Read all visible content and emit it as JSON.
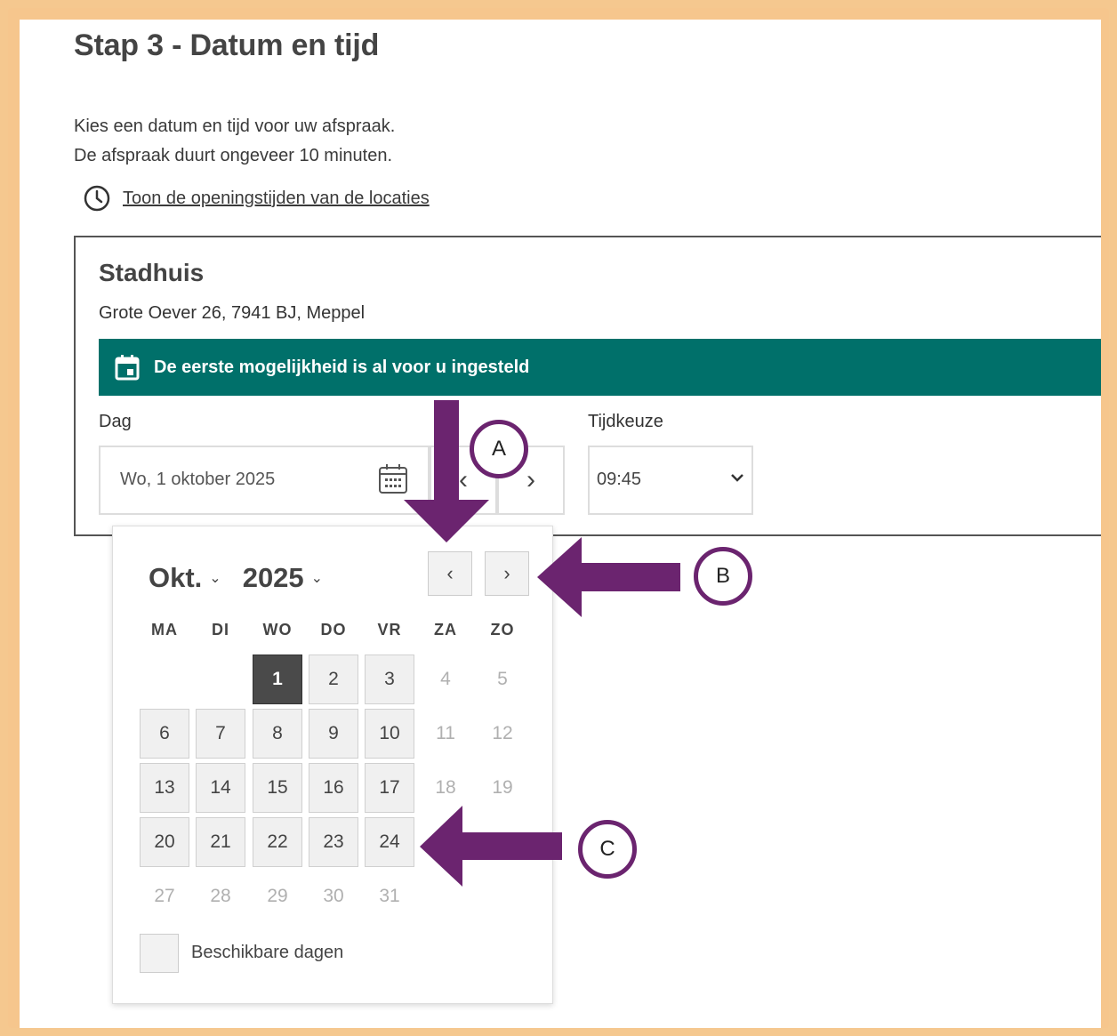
{
  "page": {
    "title": "Stap 3 - Datum en tijd",
    "intro_line1": "Kies een datum en tijd voor uw afspraak.",
    "intro_line2": "De afspraak duurt ongeveer 10 minuten.",
    "hours_link": "Toon de openingstijden van de locaties"
  },
  "location": {
    "name": "Stadhuis",
    "address": "Grote Oever 26, 7941 BJ, Meppel",
    "banner": "De eerste mogelijkheid is al voor u ingesteld",
    "day_label": "Dag",
    "date_value": "Wo, 1 oktober 2025",
    "time_label": "Tijdkeuze",
    "time_value": "09:45",
    "prev_symbol": "‹",
    "next_symbol": "›"
  },
  "calendar": {
    "month": "Okt.",
    "year": "2025",
    "prev_symbol": "‹",
    "next_symbol": "›",
    "weekdays": [
      "MA",
      "DI",
      "WO",
      "DO",
      "VR",
      "ZA",
      "ZO"
    ],
    "weeks": [
      [
        {
          "d": "",
          "s": "empty"
        },
        {
          "d": "",
          "s": "empty"
        },
        {
          "d": "1",
          "s": "selected"
        },
        {
          "d": "2",
          "s": "available"
        },
        {
          "d": "3",
          "s": "available"
        },
        {
          "d": "4",
          "s": "disabled"
        },
        {
          "d": "5",
          "s": "disabled"
        }
      ],
      [
        {
          "d": "6",
          "s": "available"
        },
        {
          "d": "7",
          "s": "available"
        },
        {
          "d": "8",
          "s": "available"
        },
        {
          "d": "9",
          "s": "available"
        },
        {
          "d": "10",
          "s": "available"
        },
        {
          "d": "11",
          "s": "disabled"
        },
        {
          "d": "12",
          "s": "disabled"
        }
      ],
      [
        {
          "d": "13",
          "s": "available"
        },
        {
          "d": "14",
          "s": "available"
        },
        {
          "d": "15",
          "s": "available"
        },
        {
          "d": "16",
          "s": "available"
        },
        {
          "d": "17",
          "s": "available"
        },
        {
          "d": "18",
          "s": "disabled"
        },
        {
          "d": "19",
          "s": "disabled"
        }
      ],
      [
        {
          "d": "20",
          "s": "available"
        },
        {
          "d": "21",
          "s": "available"
        },
        {
          "d": "22",
          "s": "available"
        },
        {
          "d": "23",
          "s": "available"
        },
        {
          "d": "24",
          "s": "available"
        },
        {
          "d": "",
          "s": "empty"
        },
        {
          "d": "",
          "s": "empty"
        }
      ],
      [
        {
          "d": "27",
          "s": "disabled"
        },
        {
          "d": "28",
          "s": "disabled"
        },
        {
          "d": "29",
          "s": "disabled"
        },
        {
          "d": "30",
          "s": "disabled"
        },
        {
          "d": "31",
          "s": "disabled"
        },
        {
          "d": "",
          "s": "empty"
        },
        {
          "d": "",
          "s": "empty"
        }
      ]
    ],
    "legend": "Beschikbare dagen"
  },
  "annotations": {
    "a": "A",
    "b": "B",
    "c": "C"
  },
  "colors": {
    "frame": "#f6c68d",
    "banner": "#00706a",
    "arrow": "#6b246f",
    "selected_day": "#4a4a4a"
  }
}
